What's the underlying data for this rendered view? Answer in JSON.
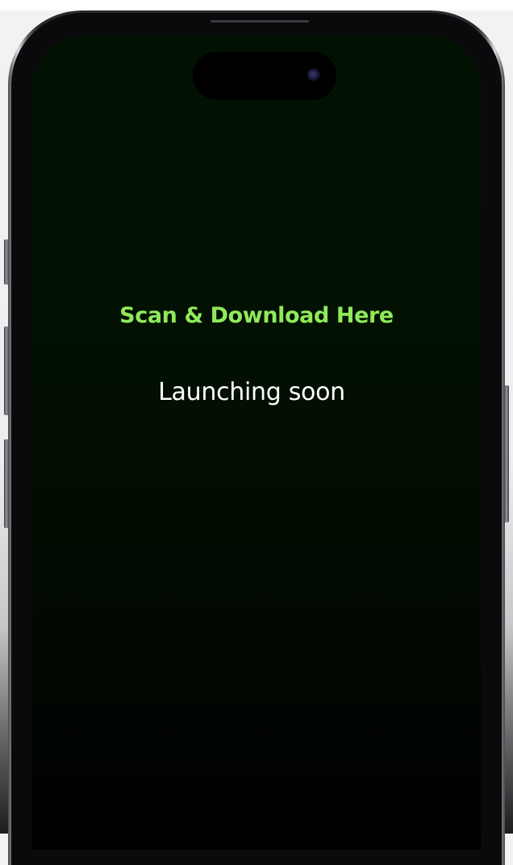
{
  "headline": "Scan & Download Here",
  "status_text": "Launching soon",
  "colors": {
    "headline": "#8fea5b",
    "status_text": "#ffffff",
    "screen_background": "#021202",
    "frame": "#2a2a2e"
  },
  "icons": {
    "front_camera": "camera-lens-icon"
  }
}
